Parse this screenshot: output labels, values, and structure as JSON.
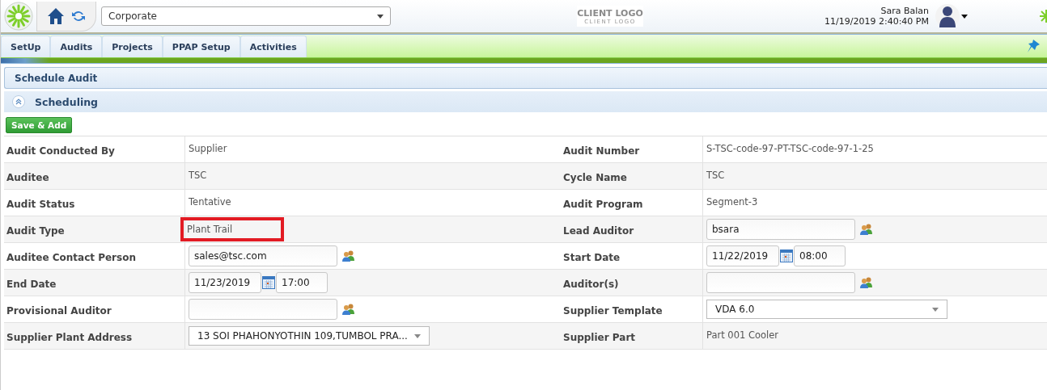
{
  "header": {
    "company_select": "Corporate",
    "client_logo": {
      "title": "CLIENT LOGO",
      "subtitle": "CLIENT LOGO"
    },
    "user": {
      "name": "Sara Balan",
      "datetime": "11/19/2019 2:40:40 PM"
    }
  },
  "tabs": [
    {
      "label": "SetUp",
      "selected": false
    },
    {
      "label": "Audits",
      "selected": false
    },
    {
      "label": "Projects",
      "selected": false
    },
    {
      "label": "PPAP Setup",
      "selected": false
    },
    {
      "label": "Activities",
      "selected": false
    }
  ],
  "page_title": "Schedule Audit",
  "section": {
    "title": "Scheduling",
    "expanded": true
  },
  "save_button": "Save & Add",
  "rows": [
    {
      "left": {
        "label": "Audit Conducted By",
        "kind": "text",
        "value": "Supplier"
      },
      "right": {
        "label": "Audit Number",
        "kind": "text",
        "value": "S-TSC-code-97-PT-TSC-code-97-1-25"
      }
    },
    {
      "left": {
        "label": "Auditee",
        "kind": "text",
        "value": "TSC"
      },
      "right": {
        "label": "Cycle Name",
        "kind": "text",
        "value": "TSC"
      }
    },
    {
      "left": {
        "label": "Audit Status",
        "kind": "text",
        "value": "Tentative"
      },
      "right": {
        "label": "Audit Program",
        "kind": "text",
        "value": "Segment-3"
      }
    },
    {
      "left": {
        "label": "Audit Type",
        "kind": "text",
        "value": "Plant Trail",
        "highlighted": true
      },
      "right": {
        "label": "Lead Auditor",
        "kind": "input",
        "value": "bsara"
      }
    },
    {
      "left": {
        "label": "Auditee Contact Person",
        "kind": "input",
        "value": "sales@tsc.com"
      },
      "right": {
        "label": "Start Date",
        "kind": "date",
        "date": "11/22/2019",
        "time": "08:00"
      }
    },
    {
      "left": {
        "label": "End Date",
        "kind": "date",
        "date": "11/23/2019",
        "time": "17:00"
      },
      "right": {
        "label": "Auditor(s)",
        "kind": "input"
      }
    },
    {
      "left": {
        "label": "Provisional Auditor",
        "kind": "input"
      },
      "right": {
        "label": "Supplier Template",
        "kind": "select",
        "value": "VDA 6.0"
      }
    },
    {
      "left": {
        "label": "Supplier Plant Address",
        "kind": "select",
        "value": "13 SOI PHAHONYOTHIN 109,TUMBOL PRA..."
      },
      "right": {
        "label": "Supplier Part",
        "kind": "text",
        "value": "Part 001 Cooler"
      }
    }
  ]
}
